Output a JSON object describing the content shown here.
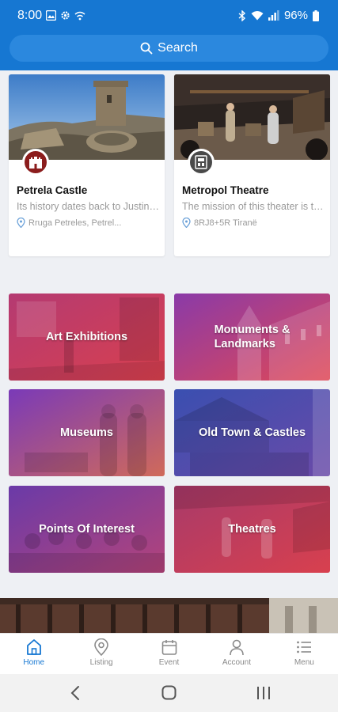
{
  "status_bar": {
    "time": "8:00",
    "battery": "96%"
  },
  "search": {
    "label": "Search"
  },
  "places": [
    {
      "name": "Petrela Castle",
      "description": "Its history dates back to Justinian's reign",
      "address": "Rruga Petreles, Petrel..."
    },
    {
      "name": "Metropol Theatre",
      "description": "The mission of this theater is to promote",
      "address": "8RJ8+5R Tiranë"
    }
  ],
  "categories": [
    {
      "label": "Art Exhibitions"
    },
    {
      "label": "Monuments &\nLandmarks"
    },
    {
      "label": "Museums"
    },
    {
      "label": "Old Town & Castles"
    },
    {
      "label": "Points Of Interest"
    },
    {
      "label": "Theatres"
    }
  ],
  "tabs": [
    {
      "label": "Home",
      "icon": "home-icon"
    },
    {
      "label": "Listing",
      "icon": "map-pin-icon"
    },
    {
      "label": "Event",
      "icon": "calendar-icon"
    },
    {
      "label": "Account",
      "icon": "person-icon"
    },
    {
      "label": "Menu",
      "icon": "menu-icon"
    }
  ],
  "colors": {
    "primary": "#1677d2",
    "tab_active": "#1677d2",
    "tab_inactive": "#8a8a8a"
  }
}
